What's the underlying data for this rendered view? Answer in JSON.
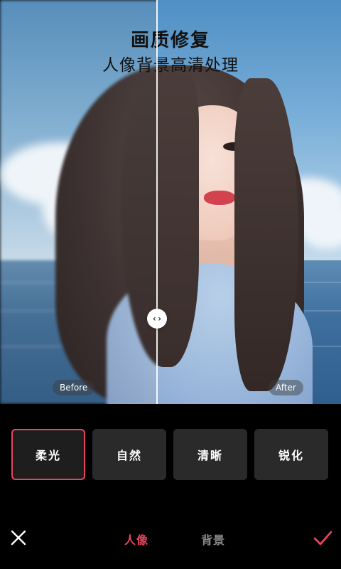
{
  "header": {
    "title": "画质修复",
    "subtitle": "人像背景高清处理"
  },
  "compare": {
    "before_label": "Before",
    "after_label": "After",
    "handle_glyph": "‹›"
  },
  "options": [
    {
      "label": "柔光",
      "selected": true
    },
    {
      "label": "自然",
      "selected": false
    },
    {
      "label": "清晰",
      "selected": false
    },
    {
      "label": "锐化",
      "selected": false
    }
  ],
  "bottom_bar": {
    "tabs": [
      {
        "label": "人像",
        "active": true
      },
      {
        "label": "背景",
        "active": false
      }
    ]
  },
  "colors": {
    "accent": "#e8455b",
    "inactive_tab": "#8a8a8a",
    "background": "#000000",
    "option_bg": "#2a2a2a"
  },
  "icons": {
    "close": "close-icon",
    "confirm": "check-icon",
    "handle": "compare-handle-icon"
  }
}
